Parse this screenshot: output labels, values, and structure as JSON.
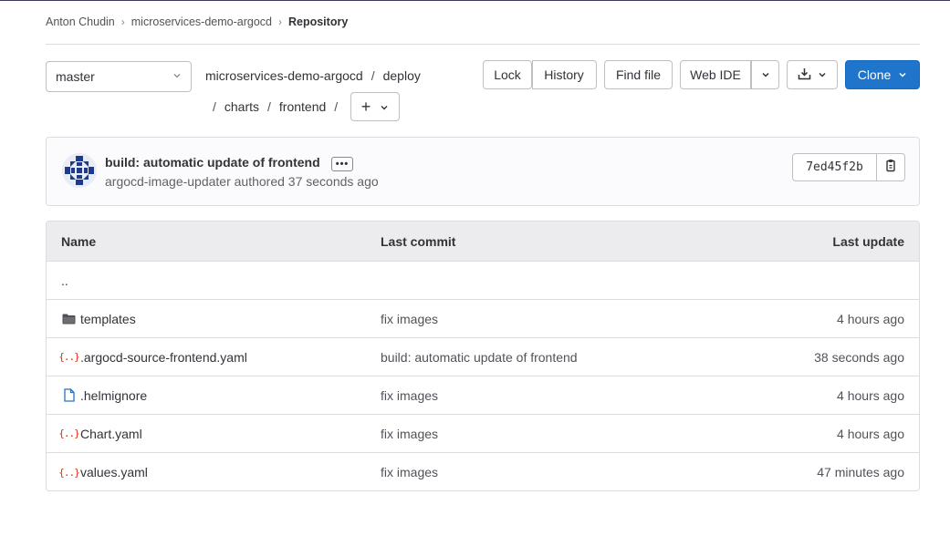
{
  "breadcrumb": [
    {
      "label": "Anton Chudin"
    },
    {
      "label": "microservices-demo-argocd"
    },
    {
      "label": "Repository"
    }
  ],
  "branch": {
    "name": "master"
  },
  "path": {
    "root": "microservices-demo-argocd",
    "seg1": "deploy",
    "seg2": "charts",
    "seg3": "frontend",
    "add_label": "+"
  },
  "toolbar": {
    "lock": "Lock",
    "history": "History",
    "find_file": "Find file",
    "web_ide": "Web IDE",
    "clone": "Clone"
  },
  "commit": {
    "title": "build: automatic update of frontend",
    "author": "argocd-image-updater",
    "meta": "argocd-image-updater authored 37 seconds ago",
    "sha": "7ed45f2b"
  },
  "table": {
    "headers": {
      "name": "Name",
      "last_commit": "Last commit",
      "last_update": "Last update"
    },
    "parent": "..",
    "rows": [
      {
        "icon": "folder-icon",
        "name": "templates",
        "commit": "fix images",
        "updated": "4 hours ago"
      },
      {
        "icon": "yaml-file-icon",
        "name": ".argocd-source-frontend.yaml",
        "commit": "build: automatic update of frontend",
        "updated": "38 seconds ago"
      },
      {
        "icon": "file-icon",
        "name": ".helmignore",
        "commit": "fix images",
        "updated": "4 hours ago"
      },
      {
        "icon": "yaml-file-icon",
        "name": "Chart.yaml",
        "commit": "fix images",
        "updated": "4 hours ago"
      },
      {
        "icon": "yaml-file-icon",
        "name": "values.yaml",
        "commit": "fix images",
        "updated": "47 minutes ago"
      }
    ]
  },
  "colors": {
    "accent": "#1f75cb",
    "yaml_icon": "#dd2b0e",
    "file_icon": "#1f75cb"
  }
}
